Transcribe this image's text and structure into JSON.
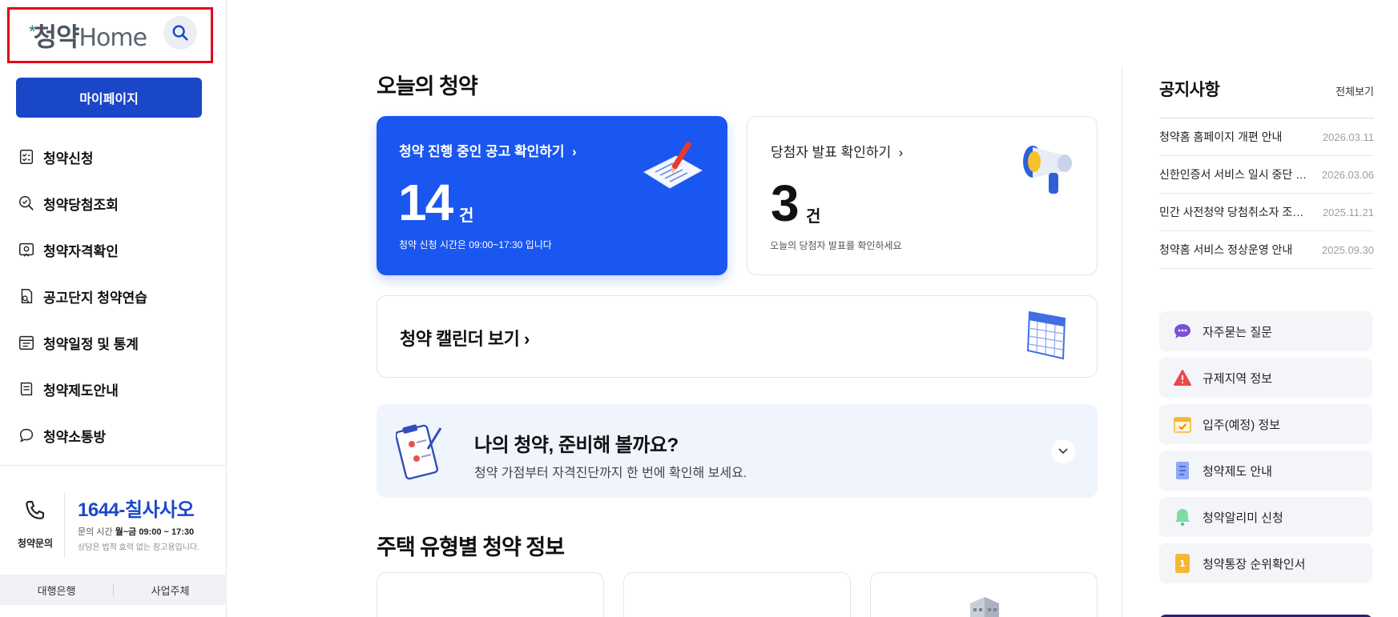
{
  "sidebar": {
    "logo": {
      "star": "*",
      "ko": "청약",
      "en": "Home"
    },
    "mypage_label": "마이페이지",
    "nav": [
      {
        "label": "청약신청",
        "icon": "checklist-icon"
      },
      {
        "label": "청약당첨조회",
        "icon": "search-check-icon"
      },
      {
        "label": "청약자격확인",
        "icon": "id-card-icon"
      },
      {
        "label": "공고단지 청약연습",
        "icon": "practice-icon"
      },
      {
        "label": "청약일정 및 통계",
        "icon": "schedule-icon"
      },
      {
        "label": "청약제도안내",
        "icon": "document-icon"
      },
      {
        "label": "청약소통방",
        "icon": "chat-bubble-icon"
      }
    ],
    "contact": {
      "label": "청약문의",
      "number": "1644-칠사사오",
      "hours_prefix": "문의 시간 ",
      "hours": "월~금 09:00 ~ 17:30",
      "note": "상담은 법적 효력 없는 참고용입니다."
    },
    "footer": [
      "대행은행",
      "사업주체"
    ]
  },
  "main": {
    "today_title": "오늘의 청약",
    "blue_card": {
      "title": "청약 진행 중인 공고 확인하기",
      "count": "14",
      "unit": "건",
      "desc": "청약 신청 시간은 09:00~17:30 입니다"
    },
    "white_card": {
      "title": "당첨자 발표 확인하기",
      "count": "3",
      "unit": "건",
      "desc": "오늘의 당첨자 발표를 확인하세요"
    },
    "calendar_title": "청약 캘린더 보기",
    "prep": {
      "title": "나의 청약, 준비해 볼까요?",
      "desc": "청약 가점부터 자격진단까지 한 번에 확인해 보세요."
    },
    "housing_title": "주택 유형별 청약 정보"
  },
  "notice": {
    "title": "공지사항",
    "all_label": "전체보기",
    "items": [
      {
        "title": "청약홈 홈페이지 개편 안내",
        "date": "2026.03.11"
      },
      {
        "title": "신한인증서 서비스 일시 중단 안내",
        "date": "2026.03.06"
      },
      {
        "title": "민간 사전청약 당첨취소자 조치 안내",
        "date": "2025.11.21"
      },
      {
        "title": "청약홈 서비스 정상운영 안내",
        "date": "2025.09.30"
      }
    ]
  },
  "quick_links": [
    {
      "label": "자주묻는 질문",
      "icon": "faq-bubble-icon",
      "color": "#7b4fd6"
    },
    {
      "label": "규제지역 정보",
      "icon": "warning-icon",
      "color": "#e84b4b"
    },
    {
      "label": "입주(예정) 정보",
      "icon": "calendar-check-icon",
      "color": "#f2b632"
    },
    {
      "label": "청약제도 안내",
      "icon": "doc-list-icon",
      "color": "#5b7ff0"
    },
    {
      "label": "청약알리미 신청",
      "icon": "bell-icon",
      "color": "#4cc98a"
    },
    {
      "label": "청약통장 순위확인서",
      "icon": "passbook-icon",
      "color": "#f5a623"
    }
  ],
  "colors": {
    "brand_blue": "#1a47c8",
    "card_blue": "#1a56f0",
    "highlight_red": "#e3001b"
  }
}
